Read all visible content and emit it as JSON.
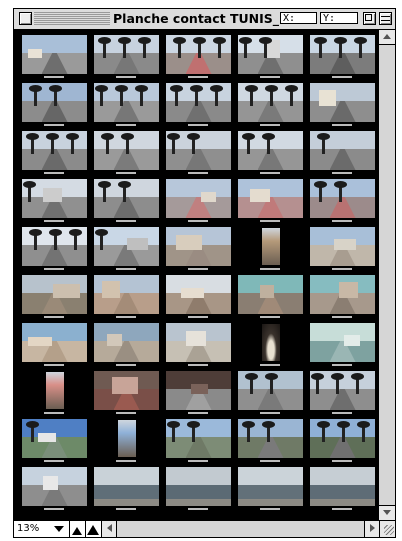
{
  "window": {
    "title": "Planche contact TUNIS_1.",
    "coord_x_label": "X:",
    "coord_y_label": "Y:"
  },
  "bottombar": {
    "zoom_level": "13%"
  },
  "icons": {
    "close": "close-box-icon",
    "zoom": "zoom-box-icon",
    "shade": "windowshade-icon",
    "small_view": "mountain-small-icon",
    "large_view": "mountain-large-icon",
    "grow": "resize-grip-icon"
  },
  "colors": {
    "sheet_background": "#000000",
    "chrome": "#dcdcdc",
    "scrollbar": "#d6d6d6"
  },
  "contact_sheet": {
    "columns": 5,
    "rows": 10,
    "thumbnails": [
      {
        "scene": "street",
        "sky": "#a9bfd8",
        "ground": "#9a9a9a",
        "road": "#6e6e6e",
        "trees": 0,
        "bldg": "#e9e2d6"
      },
      {
        "scene": "palms",
        "sky": "#c7d2df",
        "ground": "#8a8a8a",
        "road": "#777",
        "trees": 3,
        "bldg": ""
      },
      {
        "scene": "palms",
        "sky": "#ccd6e2",
        "ground": "#9b8f8a",
        "road": "#c07070",
        "trees": 3,
        "bldg": ""
      },
      {
        "scene": "street",
        "sky": "#d6dfe8",
        "ground": "#8f8f8f",
        "road": "#6f6f6f",
        "trees": 2,
        "bldg": "#d8d8d8"
      },
      {
        "scene": "palms",
        "sky": "#c9d6e3",
        "ground": "#7c7c7c",
        "road": "#5e5e5e",
        "trees": 3,
        "bldg": ""
      },
      {
        "scene": "palms",
        "sky": "#9fb6d2",
        "ground": "#8c8c8c",
        "road": "#666",
        "trees": 2,
        "bldg": ""
      },
      {
        "scene": "palms",
        "sky": "#b9c8da",
        "ground": "#9a9a9a",
        "road": "#777",
        "trees": 3,
        "bldg": ""
      },
      {
        "scene": "palms",
        "sky": "#c8d3df",
        "ground": "#8a8a8a",
        "road": "#707070",
        "trees": 3,
        "bldg": ""
      },
      {
        "scene": "palms",
        "sky": "#cfd8e1",
        "ground": "#959595",
        "road": "#7a7a7a",
        "trees": 3,
        "bldg": ""
      },
      {
        "scene": "street",
        "sky": "#bdc9d6",
        "ground": "#8e8e8e",
        "road": "#6a6a6a",
        "trees": 0,
        "bldg": "#e8e2d4"
      },
      {
        "scene": "palms",
        "sky": "#c8d2dd",
        "ground": "#8b8b8b",
        "road": "#6a6a6a",
        "trees": 3,
        "bldg": ""
      },
      {
        "scene": "palms",
        "sky": "#d0d7df",
        "ground": "#9a9a9a",
        "road": "#7b7b7b",
        "trees": 2,
        "bldg": ""
      },
      {
        "scene": "palms",
        "sky": "#cbd3dc",
        "ground": "#8f8f8f",
        "road": "#777",
        "trees": 2,
        "bldg": ""
      },
      {
        "scene": "street",
        "sky": "#d1d9e2",
        "ground": "#969696",
        "road": "#787878",
        "trees": 2,
        "bldg": ""
      },
      {
        "scene": "street",
        "sky": "#c4ced9",
        "ground": "#8b8b8b",
        "road": "#6b6b6b",
        "trees": 1,
        "bldg": ""
      },
      {
        "scene": "street",
        "sky": "#d4dbe3",
        "ground": "#909090",
        "road": "#707070",
        "trees": 1,
        "bldg": "#cccccc"
      },
      {
        "scene": "street",
        "sky": "#cfd6de",
        "ground": "#8d8d8d",
        "road": "#6d6d6d",
        "trees": 2,
        "bldg": ""
      },
      {
        "scene": "street",
        "sky": "#b7c7da",
        "ground": "#a59a9a",
        "road": "#c08080",
        "trees": 0,
        "bldg": "#e0d8cc"
      },
      {
        "scene": "street",
        "sky": "#aec2da",
        "ground": "#b59090",
        "road": "#c07a7a",
        "trees": 0,
        "bldg": "#e4dccf"
      },
      {
        "scene": "palms",
        "sky": "#aac0da",
        "ground": "#9c8b8b",
        "road": "#b87272",
        "trees": 2,
        "bldg": ""
      },
      {
        "scene": "palms",
        "sky": "#dfe5ec",
        "ground": "#8f8f8f",
        "road": "#737373",
        "trees": 3,
        "bldg": ""
      },
      {
        "scene": "street",
        "sky": "#c9d7e6",
        "ground": "#9a9a9a",
        "road": "#7a7a7a",
        "trees": 1,
        "bldg": "#bfbfbf"
      },
      {
        "scene": "street",
        "sky": "#b6c5d7",
        "ground": "#a09488",
        "road": "#9a8c82",
        "trees": 0,
        "bldg": "#d8cdbd"
      },
      {
        "scene": "tower",
        "sky": "#000000",
        "ground": "#000000",
        "road": "#000000",
        "trees": 0,
        "bldg": "#b59a7a"
      },
      {
        "scene": "street",
        "sky": "#a8bfd8",
        "ground": "#c0b7aa",
        "road": "#a89d90",
        "trees": 0,
        "bldg": "#d8d3c8"
      },
      {
        "scene": "street",
        "sky": "#b7c2cc",
        "ground": "#8a8070",
        "road": "#9a8a78",
        "trees": 0,
        "bldg": "#ccbfae"
      },
      {
        "scene": "street",
        "sky": "#b4c3d3",
        "ground": "#b89e8a",
        "road": "#a48c78",
        "trees": 0,
        "bldg": "#d2c2ae"
      },
      {
        "scene": "street",
        "sky": "#d8dde2",
        "ground": "#a89686",
        "road": "#8f7c6c",
        "trees": 0,
        "bldg": "#e6ddd0"
      },
      {
        "scene": "street",
        "sky": "#7fb8b8",
        "ground": "#8a7e72",
        "road": "#a08a78",
        "trees": 0,
        "bldg": "#bfb09e"
      },
      {
        "scene": "street",
        "sky": "#86bcc0",
        "ground": "#a7998c",
        "road": "#8b7e72",
        "trees": 0,
        "bldg": "#c8b8a6"
      },
      {
        "scene": "street",
        "sky": "#8bb0cf",
        "ground": "#c7b6a2",
        "road": "#b4a08a",
        "trees": 0,
        "bldg": "#e3d6c4"
      },
      {
        "scene": "street",
        "sky": "#8ea7bd",
        "ground": "#b6aa9a",
        "road": "#9a8f82",
        "trees": 0,
        "bldg": "#d2c8ba"
      },
      {
        "scene": "street",
        "sky": "#b9c4cf",
        "ground": "#c6c0b4",
        "road": "#aaa295",
        "trees": 0,
        "bldg": "#e6e2da"
      },
      {
        "scene": "arch",
        "sky": "#000000",
        "ground": "#000000",
        "road": "#000000",
        "trees": 0,
        "bldg": "#8c8070"
      },
      {
        "scene": "street",
        "sky": "#c7ddd8",
        "ground": "#7ea2a0",
        "road": "#9ab6b4",
        "trees": 0,
        "bldg": "#e3ece9"
      },
      {
        "scene": "door",
        "sky": "#000000",
        "ground": "#000000",
        "road": "#000000",
        "trees": 0,
        "bldg": "#d88f88"
      },
      {
        "scene": "street",
        "sky": "#6f5a52",
        "ground": "#7a4f48",
        "road": "#9a5a50",
        "trees": 0,
        "bldg": "#c8a498"
      },
      {
        "scene": "street",
        "sky": "#4e3d38",
        "ground": "#8a8a8a",
        "road": "#a0a0a0",
        "trees": 0,
        "bldg": "#7a625a"
      },
      {
        "scene": "palms",
        "sky": "#b1c1cf",
        "ground": "#8f8f8f",
        "road": "#7a7a7a",
        "trees": 2,
        "bldg": ""
      },
      {
        "scene": "palms",
        "sky": "#c6d0db",
        "ground": "#8e8e8e",
        "road": "#6e6e6e",
        "trees": 3,
        "bldg": ""
      },
      {
        "scene": "street",
        "sky": "#4f7fc4",
        "ground": "#6d8a68",
        "road": "#7a8f7a",
        "trees": 1,
        "bldg": "#e6e6e6"
      },
      {
        "scene": "tower",
        "sky": "#000000",
        "ground": "#000000",
        "road": "#000000",
        "trees": 0,
        "bldg": "#8fb1d8"
      },
      {
        "scene": "palms",
        "sky": "#9bb9da",
        "ground": "#7d8c76",
        "road": "#6f7a66",
        "trees": 2,
        "bldg": ""
      },
      {
        "scene": "palms",
        "sky": "#9ab5d3",
        "ground": "#6f7a66",
        "road": "#7a7a7a",
        "trees": 2,
        "bldg": ""
      },
      {
        "scene": "palms",
        "sky": "#8fb0d6",
        "ground": "#5f6f58",
        "road": "#707070",
        "trees": 3,
        "bldg": ""
      },
      {
        "scene": "street",
        "sky": "#c6d2de",
        "ground": "#8e8e8e",
        "road": "#7a7a7a",
        "trees": 0,
        "bldg": "#e8e8e8"
      },
      {
        "scene": "sea",
        "sky": "#c9d2d8",
        "ground": "#5f6e78",
        "road": "#5f6e78",
        "trees": 0,
        "bldg": ""
      },
      {
        "scene": "sea",
        "sky": "#c2cad0",
        "ground": "#5b6a74",
        "road": "#5b6a74",
        "trees": 0,
        "bldg": ""
      },
      {
        "scene": "sea",
        "sky": "#cbd3d9",
        "ground": "#627079",
        "road": "#627079",
        "trees": 0,
        "bldg": ""
      },
      {
        "scene": "sea",
        "sky": "#c6ced4",
        "ground": "#5e6c76",
        "road": "#5e6c76",
        "trees": 0,
        "bldg": ""
      }
    ]
  }
}
